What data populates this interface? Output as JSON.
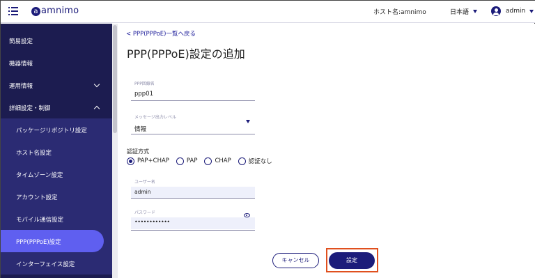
{
  "header": {
    "logo": "amnimo",
    "logo_mark": "a",
    "hostname": "ホスト名:amnimo",
    "language": "日本語",
    "user": "admin"
  },
  "sidebar": {
    "items": [
      {
        "label": "簡易設定",
        "type": "top"
      },
      {
        "label": "機器情報",
        "type": "top"
      },
      {
        "label": "運用情報",
        "type": "top",
        "chevron": "down"
      },
      {
        "label": "詳細設定・制御",
        "type": "top",
        "chevron": "up"
      },
      {
        "label": "パッケージリポジトリ設定",
        "type": "sub"
      },
      {
        "label": "ホスト名設定",
        "type": "sub"
      },
      {
        "label": "タイムゾーン設定",
        "type": "sub"
      },
      {
        "label": "アカウント設定",
        "type": "sub"
      },
      {
        "label": "モバイル通信設定",
        "type": "sub"
      },
      {
        "label": "PPP(PPPoE)設定",
        "type": "sub",
        "active": true
      },
      {
        "label": "インターフェイス設定",
        "type": "sub"
      }
    ]
  },
  "main": {
    "back_link": "< PPP(PPPoE)一覧へ戻る",
    "title": "PPP(PPPoE)設定の追加",
    "ppp_name": {
      "label": "PPP回線名",
      "value": "ppp01"
    },
    "log_level": {
      "label": "メッセージ出力レベル",
      "value": "情報"
    },
    "auth": {
      "label": "認証方式",
      "options": [
        "PAP+CHAP",
        "PAP",
        "CHAP",
        "認証なし"
      ],
      "selected": "PAP+CHAP"
    },
    "username": {
      "label": "ユーザー名",
      "value": "admin"
    },
    "password": {
      "label": "パスワード",
      "value": "••••••••••••"
    },
    "cancel_label": "キャンセル",
    "save_label": "設定"
  },
  "colors": {
    "navy": "#1c1c7a",
    "sidebar_bg": "#1c1c50",
    "active_pill": "#5f5ff0",
    "highlight_border": "#e0501e"
  }
}
